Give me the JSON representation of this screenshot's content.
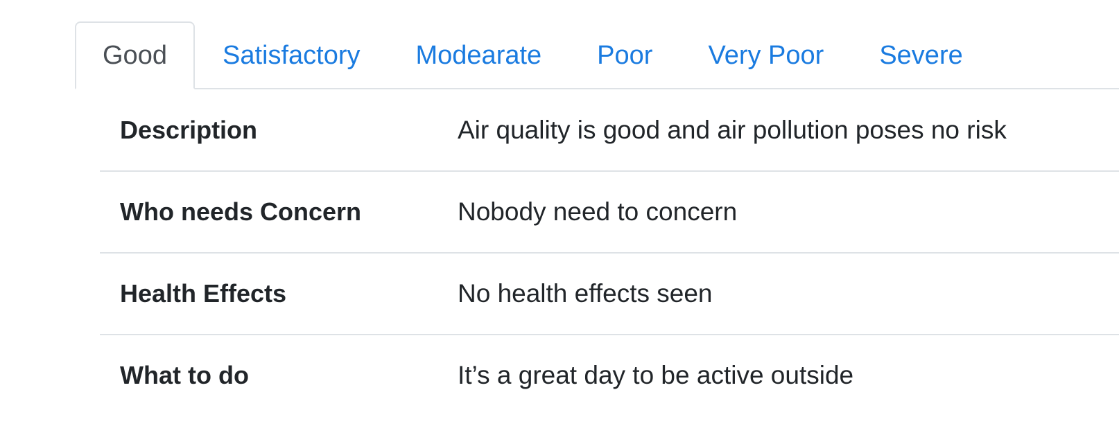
{
  "tabs": [
    {
      "label": "Good",
      "active": true
    },
    {
      "label": "Satisfactory",
      "active": false
    },
    {
      "label": "Modearate",
      "active": false
    },
    {
      "label": "Poor",
      "active": false
    },
    {
      "label": "Very Poor",
      "active": false
    },
    {
      "label": "Severe",
      "active": false
    }
  ],
  "table": {
    "rows": [
      {
        "label": "Description",
        "value": "Air quality is good and air pollution poses no risk"
      },
      {
        "label": "Who needs Concern",
        "value": "Nobody need to concern"
      },
      {
        "label": "Health Effects",
        "value": "No health effects seen"
      },
      {
        "label": "What to do",
        "value": "It’s a great day to be active outside"
      }
    ]
  },
  "colors": {
    "link": "#1a7be0",
    "active_tab_text": "#4a4f55",
    "border": "#dee2e6",
    "text": "#212529"
  }
}
